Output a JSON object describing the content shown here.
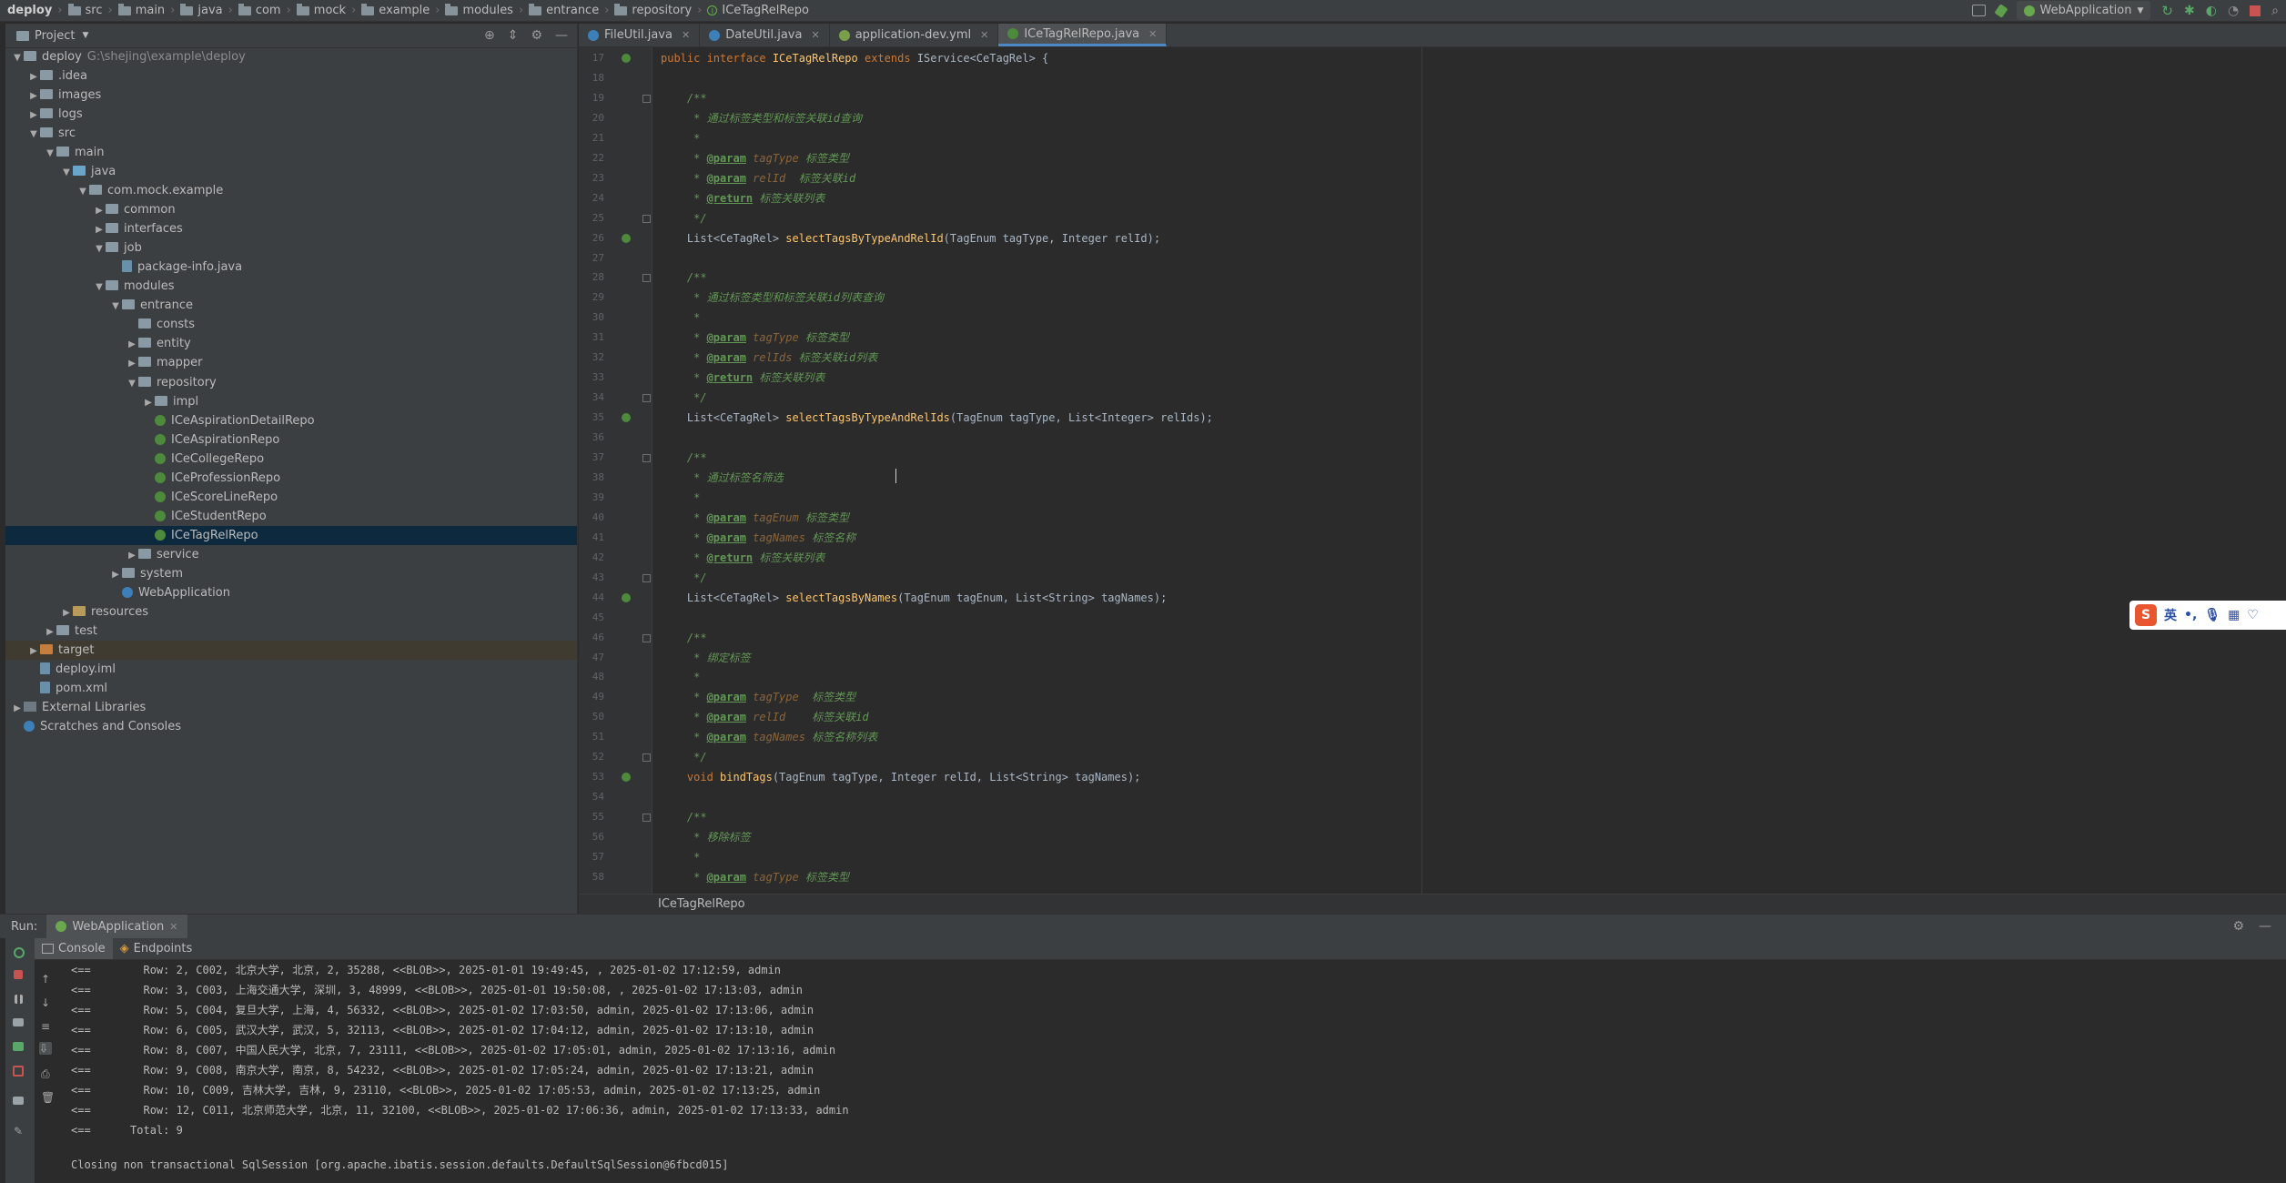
{
  "navbar": {
    "crumbs": [
      "deploy",
      "src",
      "main",
      "java",
      "com",
      "mock",
      "example",
      "modules",
      "entrance",
      "repository",
      "ICeTagRelRepo"
    ],
    "run_config": "WebApplication"
  },
  "project": {
    "title": "Project",
    "tree": [
      {
        "label": "deploy",
        "path": "G:\\shejing\\example\\deploy",
        "depth": 0,
        "icon": "folder",
        "expanded": true
      },
      {
        "label": ".idea",
        "depth": 1,
        "icon": "folder",
        "expanded": false
      },
      {
        "label": "images",
        "depth": 1,
        "icon": "folder",
        "expanded": false
      },
      {
        "label": "logs",
        "depth": 1,
        "icon": "folder",
        "expanded": false
      },
      {
        "label": "src",
        "depth": 1,
        "icon": "folder",
        "expanded": true
      },
      {
        "label": "main",
        "depth": 2,
        "icon": "folder",
        "expanded": true
      },
      {
        "label": "java",
        "depth": 3,
        "icon": "folder-src",
        "expanded": true
      },
      {
        "label": "com.mock.example",
        "depth": 4,
        "icon": "package",
        "expanded": true
      },
      {
        "label": "common",
        "depth": 5,
        "icon": "package",
        "expanded": false
      },
      {
        "label": "interfaces",
        "depth": 5,
        "icon": "package",
        "expanded": false
      },
      {
        "label": "job",
        "depth": 5,
        "icon": "package",
        "expanded": true
      },
      {
        "label": "package-info.java",
        "depth": 6,
        "icon": "file",
        "leaf": true
      },
      {
        "label": "modules",
        "depth": 5,
        "icon": "package",
        "expanded": true
      },
      {
        "label": "entrance",
        "depth": 6,
        "icon": "package",
        "expanded": true
      },
      {
        "label": "consts",
        "depth": 7,
        "icon": "package",
        "leaf": true
      },
      {
        "label": "entity",
        "depth": 7,
        "icon": "package",
        "expanded": false
      },
      {
        "label": "mapper",
        "depth": 7,
        "icon": "package",
        "expanded": false
      },
      {
        "label": "repository",
        "depth": 7,
        "icon": "package",
        "expanded": true
      },
      {
        "label": "impl",
        "depth": 8,
        "icon": "package",
        "expanded": false
      },
      {
        "label": "ICeAspirationDetailRepo",
        "depth": 8,
        "icon": "interface",
        "leaf": true
      },
      {
        "label": "ICeAspirationRepo",
        "depth": 8,
        "icon": "interface",
        "leaf": true
      },
      {
        "label": "ICeCollegeRepo",
        "depth": 8,
        "icon": "interface",
        "leaf": true
      },
      {
        "label": "ICeProfessionRepo",
        "depth": 8,
        "icon": "interface",
        "leaf": true
      },
      {
        "label": "ICeScoreLineRepo",
        "depth": 8,
        "icon": "interface",
        "leaf": true
      },
      {
        "label": "ICeStudentRepo",
        "depth": 8,
        "icon": "interface",
        "leaf": true
      },
      {
        "label": "ICeTagRelRepo",
        "depth": 8,
        "icon": "interface",
        "leaf": true,
        "selected": true
      },
      {
        "label": "service",
        "depth": 7,
        "icon": "package",
        "expanded": false
      },
      {
        "label": "system",
        "depth": 6,
        "icon": "package",
        "expanded": false
      },
      {
        "label": "WebApplication",
        "depth": 6,
        "icon": "class",
        "leaf": true
      },
      {
        "label": "resources",
        "depth": 3,
        "icon": "folder-res",
        "expanded": false
      },
      {
        "label": "test",
        "depth": 2,
        "icon": "folder",
        "expanded": false
      },
      {
        "label": "target",
        "depth": 1,
        "icon": "folder-excluded",
        "expanded": false,
        "excluded": true
      },
      {
        "label": "deploy.iml",
        "depth": 1,
        "icon": "file",
        "leaf": true
      },
      {
        "label": "pom.xml",
        "depth": 1,
        "icon": "file",
        "leaf": true
      },
      {
        "label": "External Libraries",
        "depth": 0,
        "icon": "library",
        "expanded": false
      },
      {
        "label": "Scratches and Consoles",
        "depth": 0,
        "icon": "scratch",
        "leaf": true
      }
    ]
  },
  "editor": {
    "tabs": [
      {
        "label": "FileUtil.java",
        "active": false,
        "color": "#3d7fb8"
      },
      {
        "label": "DateUtil.java",
        "active": false,
        "color": "#3d7fb8"
      },
      {
        "label": "application-dev.yml",
        "active": false,
        "color": "#7a9f4a"
      },
      {
        "label": "ICeTagRelRepo.java",
        "active": true,
        "color": "#4d8a3b"
      }
    ],
    "breadcrumb": "ICeTagRelRepo",
    "lines": [
      {
        "n": "17",
        "mark": true,
        "fold": false,
        "segs": [
          [
            "kw",
            "public interface "
          ],
          [
            "fn",
            "ICeTagRelRepo "
          ],
          [
            "kw",
            "extends "
          ],
          [
            "typ",
            "IService<CeTagRel> {"
          ]
        ]
      },
      {
        "n": "18",
        "segs": []
      },
      {
        "n": "19",
        "fold": true,
        "segs": [
          [
            "cm",
            "    /**"
          ]
        ]
      },
      {
        "n": "20",
        "segs": [
          [
            "cm",
            "     * 通过标签类型和标签关联id查询"
          ]
        ]
      },
      {
        "n": "21",
        "segs": [
          [
            "cm",
            "     *"
          ]
        ]
      },
      {
        "n": "22",
        "segs": [
          [
            "cm",
            "     * "
          ],
          [
            "cm-tag",
            "@param"
          ],
          [
            "cm-param",
            " tagType"
          ],
          [
            "cm",
            " 标签类型"
          ]
        ]
      },
      {
        "n": "23",
        "segs": [
          [
            "cm",
            "     * "
          ],
          [
            "cm-tag",
            "@param"
          ],
          [
            "cm-param",
            " relId"
          ],
          [
            "cm",
            "  标签关联id"
          ]
        ]
      },
      {
        "n": "24",
        "segs": [
          [
            "cm",
            "     * "
          ],
          [
            "cm-tag",
            "@return"
          ],
          [
            "cm",
            " 标签关联列表"
          ]
        ]
      },
      {
        "n": "25",
        "fold": true,
        "segs": [
          [
            "cm",
            "     */"
          ]
        ]
      },
      {
        "n": "26",
        "mark": true,
        "segs": [
          [
            "typ",
            "    List<CeTagRel> "
          ],
          [
            "fn",
            "selectTagsByTypeAndRelId"
          ],
          [
            "typ",
            "(TagEnum tagType, Integer relId);"
          ]
        ]
      },
      {
        "n": "27",
        "segs": []
      },
      {
        "n": "28",
        "fold": true,
        "segs": [
          [
            "cm",
            "    /**"
          ]
        ]
      },
      {
        "n": "29",
        "segs": [
          [
            "cm",
            "     * 通过标签类型和标签关联id列表查询"
          ]
        ]
      },
      {
        "n": "30",
        "segs": [
          [
            "cm",
            "     *"
          ]
        ]
      },
      {
        "n": "31",
        "segs": [
          [
            "cm",
            "     * "
          ],
          [
            "cm-tag",
            "@param"
          ],
          [
            "cm-param",
            " tagType"
          ],
          [
            "cm",
            " 标签类型"
          ]
        ]
      },
      {
        "n": "32",
        "segs": [
          [
            "cm",
            "     * "
          ],
          [
            "cm-tag",
            "@param"
          ],
          [
            "cm-param",
            " relIds"
          ],
          [
            "cm",
            " 标签关联id列表"
          ]
        ]
      },
      {
        "n": "33",
        "segs": [
          [
            "cm",
            "     * "
          ],
          [
            "cm-tag",
            "@return"
          ],
          [
            "cm",
            " 标签关联列表"
          ]
        ]
      },
      {
        "n": "34",
        "fold": true,
        "segs": [
          [
            "cm",
            "     */"
          ]
        ]
      },
      {
        "n": "35",
        "mark": true,
        "segs": [
          [
            "typ",
            "    List<CeTagRel> "
          ],
          [
            "fn",
            "selectTagsByTypeAndRelIds"
          ],
          [
            "typ",
            "(TagEnum tagType, List<Integer> relIds);"
          ]
        ]
      },
      {
        "n": "36",
        "segs": []
      },
      {
        "n": "37",
        "fold": true,
        "segs": [
          [
            "cm",
            "    /**"
          ]
        ]
      },
      {
        "n": "38",
        "segs": [
          [
            "cm",
            "     * 通过标签名筛选"
          ]
        ]
      },
      {
        "n": "39",
        "segs": [
          [
            "cm",
            "     *"
          ]
        ]
      },
      {
        "n": "40",
        "segs": [
          [
            "cm",
            "     * "
          ],
          [
            "cm-tag",
            "@param"
          ],
          [
            "cm-param",
            " tagEnum"
          ],
          [
            "cm",
            " 标签类型"
          ]
        ]
      },
      {
        "n": "41",
        "segs": [
          [
            "cm",
            "     * "
          ],
          [
            "cm-tag",
            "@param"
          ],
          [
            "cm-param",
            " tagNames"
          ],
          [
            "cm",
            " 标签名称"
          ]
        ]
      },
      {
        "n": "42",
        "segs": [
          [
            "cm",
            "     * "
          ],
          [
            "cm-tag",
            "@return"
          ],
          [
            "cm",
            " 标签关联列表"
          ]
        ]
      },
      {
        "n": "43",
        "fold": true,
        "segs": [
          [
            "cm",
            "     */"
          ]
        ]
      },
      {
        "n": "44",
        "mark": true,
        "segs": [
          [
            "typ",
            "    List<CeTagRel> "
          ],
          [
            "fn",
            "selectTagsByNames"
          ],
          [
            "typ",
            "(TagEnum tagEnum, List<String> tagNames);"
          ]
        ]
      },
      {
        "n": "45",
        "segs": []
      },
      {
        "n": "46",
        "fold": true,
        "segs": [
          [
            "cm",
            "    /**"
          ]
        ]
      },
      {
        "n": "47",
        "segs": [
          [
            "cm",
            "     * 绑定标签"
          ]
        ]
      },
      {
        "n": "48",
        "segs": [
          [
            "cm",
            "     *"
          ]
        ]
      },
      {
        "n": "49",
        "segs": [
          [
            "cm",
            "     * "
          ],
          [
            "cm-tag",
            "@param"
          ],
          [
            "cm-param",
            " tagType"
          ],
          [
            "cm",
            "  标签类型"
          ]
        ]
      },
      {
        "n": "50",
        "segs": [
          [
            "cm",
            "     * "
          ],
          [
            "cm-tag",
            "@param"
          ],
          [
            "cm-param",
            " relId"
          ],
          [
            "cm",
            "    标签关联id"
          ]
        ]
      },
      {
        "n": "51",
        "segs": [
          [
            "cm",
            "     * "
          ],
          [
            "cm-tag",
            "@param"
          ],
          [
            "cm-param",
            " tagNames"
          ],
          [
            "cm",
            " 标签名称列表"
          ]
        ]
      },
      {
        "n": "52",
        "fold": true,
        "segs": [
          [
            "cm",
            "     */"
          ]
        ]
      },
      {
        "n": "53",
        "mark": true,
        "segs": [
          [
            "kw",
            "    void "
          ],
          [
            "fn",
            "bindTags"
          ],
          [
            "typ",
            "(TagEnum tagType, Integer relId, List<String> tagNames);"
          ]
        ]
      },
      {
        "n": "54",
        "segs": []
      },
      {
        "n": "55",
        "fold": true,
        "segs": [
          [
            "cm",
            "    /**"
          ]
        ]
      },
      {
        "n": "56",
        "segs": [
          [
            "cm",
            "     * 移除标签"
          ]
        ]
      },
      {
        "n": "57",
        "segs": [
          [
            "cm",
            "     *"
          ]
        ]
      },
      {
        "n": "58",
        "segs": [
          [
            "cm",
            "     * "
          ],
          [
            "cm-tag",
            "@param"
          ],
          [
            "cm-param",
            " tagType"
          ],
          [
            "cm",
            " 标签类型"
          ]
        ]
      }
    ]
  },
  "ime": {
    "logo": "S",
    "mode": "英"
  },
  "run": {
    "label": "Run:",
    "tab": "WebApplication",
    "subtabs": [
      "Console",
      "Endpoints"
    ],
    "console_lines": [
      "<==        Row: 2, C002, 北京大学, 北京, 2, 35288, <<BLOB>>, 2025-01-01 19:49:45, , 2025-01-02 17:12:59, admin",
      "<==        Row: 3, C003, 上海交通大学, 深圳, 3, 48999, <<BLOB>>, 2025-01-01 19:50:08, , 2025-01-02 17:13:03, admin",
      "<==        Row: 5, C004, 复旦大学, 上海, 4, 56332, <<BLOB>>, 2025-01-02 17:03:50, admin, 2025-01-02 17:13:06, admin",
      "<==        Row: 6, C005, 武汉大学, 武汉, 5, 32113, <<BLOB>>, 2025-01-02 17:04:12, admin, 2025-01-02 17:13:10, admin",
      "<==        Row: 8, C007, 中国人民大学, 北京, 7, 23111, <<BLOB>>, 2025-01-02 17:05:01, admin, 2025-01-02 17:13:16, admin",
      "<==        Row: 9, C008, 南京大学, 南京, 8, 54232, <<BLOB>>, 2025-01-02 17:05:24, admin, 2025-01-02 17:13:21, admin",
      "<==        Row: 10, C009, 吉林大学, 吉林, 9, 23110, <<BLOB>>, 2025-01-02 17:05:53, admin, 2025-01-02 17:13:25, admin",
      "<==        Row: 12, C011, 北京师范大学, 北京, 11, 32100, <<BLOB>>, 2025-01-02 17:06:36, admin, 2025-01-02 17:13:33, admin",
      "<==      Total: 9",
      "Closing non transactional SqlSession [org.apache.ibatis.session.defaults.DefaultSqlSession@6fbcd015]"
    ]
  }
}
